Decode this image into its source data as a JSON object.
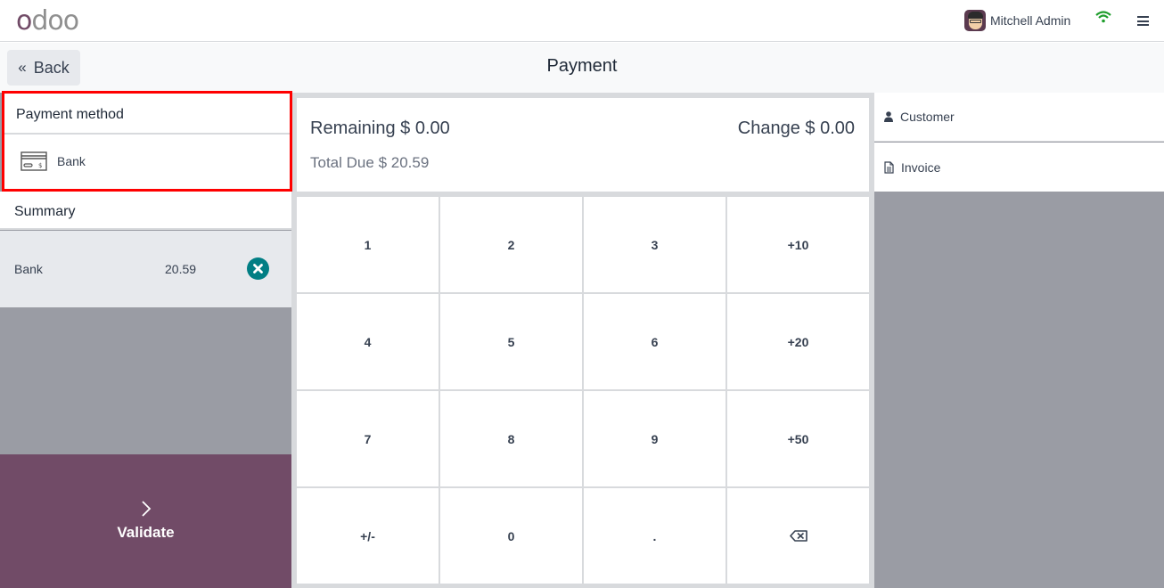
{
  "navbar": {
    "logo": {
      "first": "o",
      "rest": "doo"
    },
    "user_name": "Mitchell Admin",
    "icons": {
      "avatar": "user-avatar",
      "connection": "wifi-icon",
      "menu": "hamburger-menu-icon"
    }
  },
  "control_bar": {
    "back_label": "Back",
    "back_icon": "double-chevron-left-icon",
    "title": "Payment"
  },
  "payment_methods": {
    "title": "Payment method",
    "items": [
      {
        "label": "Bank",
        "icon": "credit-card-icon"
      }
    ]
  },
  "summary": {
    "title": "Summary",
    "lines": [
      {
        "method": "Bank",
        "amount": "20.59",
        "delete_icon": "close-circle-icon"
      }
    ]
  },
  "totals": {
    "remaining_label": "Remaining",
    "remaining_value": "$ 0.00",
    "change_label": "Change",
    "change_value": "$ 0.00",
    "total_due_label": "Total Due",
    "total_due_value": "$ 20.59"
  },
  "numpad": {
    "keys": [
      "1",
      "2",
      "3",
      "+10",
      "4",
      "5",
      "6",
      "+20",
      "7",
      "8",
      "9",
      "+50",
      "+/-",
      "0",
      ".",
      "backspace"
    ]
  },
  "validate": {
    "label": "Validate",
    "icon": "chevron-right-icon"
  },
  "right_panel": {
    "customer_label": "Customer",
    "invoice_label": "Invoice"
  },
  "colors": {
    "brand": "#714B67",
    "delete_accent": "#017e84",
    "highlight_border": "#ff0000",
    "wifi": "#1f9d2c"
  }
}
